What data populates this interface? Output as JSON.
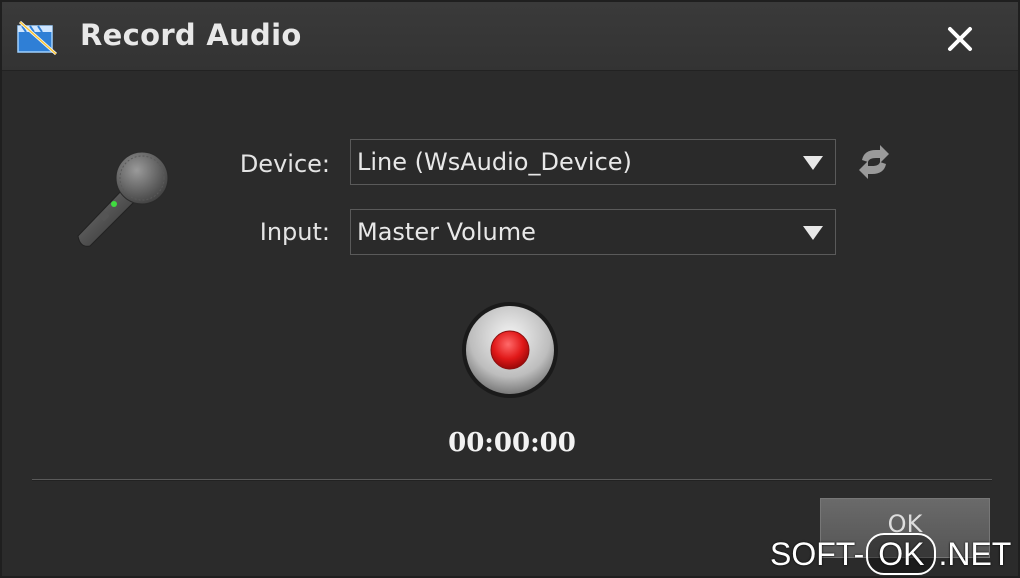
{
  "window": {
    "title": "Record Audio",
    "close_icon": "close-icon",
    "app_icon": "video-editor-app-icon"
  },
  "form": {
    "device_label": "Device:",
    "device_value": "Line (WsAudio_Device)",
    "input_label": "Input:",
    "input_value": "Master Volume",
    "refresh_icon": "refresh-icon"
  },
  "recorder": {
    "record_icon": "record-icon",
    "timer": "00:00:00"
  },
  "footer": {
    "ok_label": "OK"
  },
  "watermark": {
    "left": "SOFT-",
    "pill": "OK",
    "right": ".NET"
  },
  "colors": {
    "background": "#2b2b2b",
    "titlebar": "#363636",
    "record_red": "#e01818"
  }
}
